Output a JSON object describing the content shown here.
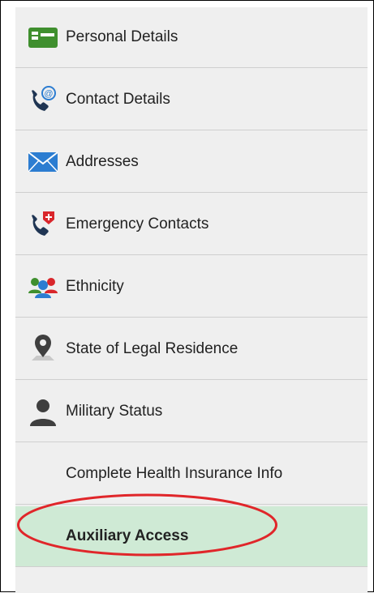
{
  "sidebar": {
    "items": [
      {
        "label": "Personal Details",
        "icon": "personal-details-icon"
      },
      {
        "label": "Contact Details",
        "icon": "phone-at-icon"
      },
      {
        "label": "Addresses",
        "icon": "envelope-icon"
      },
      {
        "label": "Emergency Contacts",
        "icon": "emergency-phone-icon"
      },
      {
        "label": "Ethnicity",
        "icon": "people-icon"
      },
      {
        "label": "State of Legal Residence",
        "icon": "location-pin-icon"
      },
      {
        "label": "Military Status",
        "icon": "person-icon"
      },
      {
        "label": "Complete Health Insurance Info",
        "icon": ""
      },
      {
        "label": "Auxiliary Access",
        "icon": "",
        "active": true
      }
    ]
  },
  "colors": {
    "active_background": "#cfead5",
    "highlight_oval": "#e0262a",
    "green_icon": "#3f8f2e",
    "blue_icon": "#2c7dd1"
  }
}
